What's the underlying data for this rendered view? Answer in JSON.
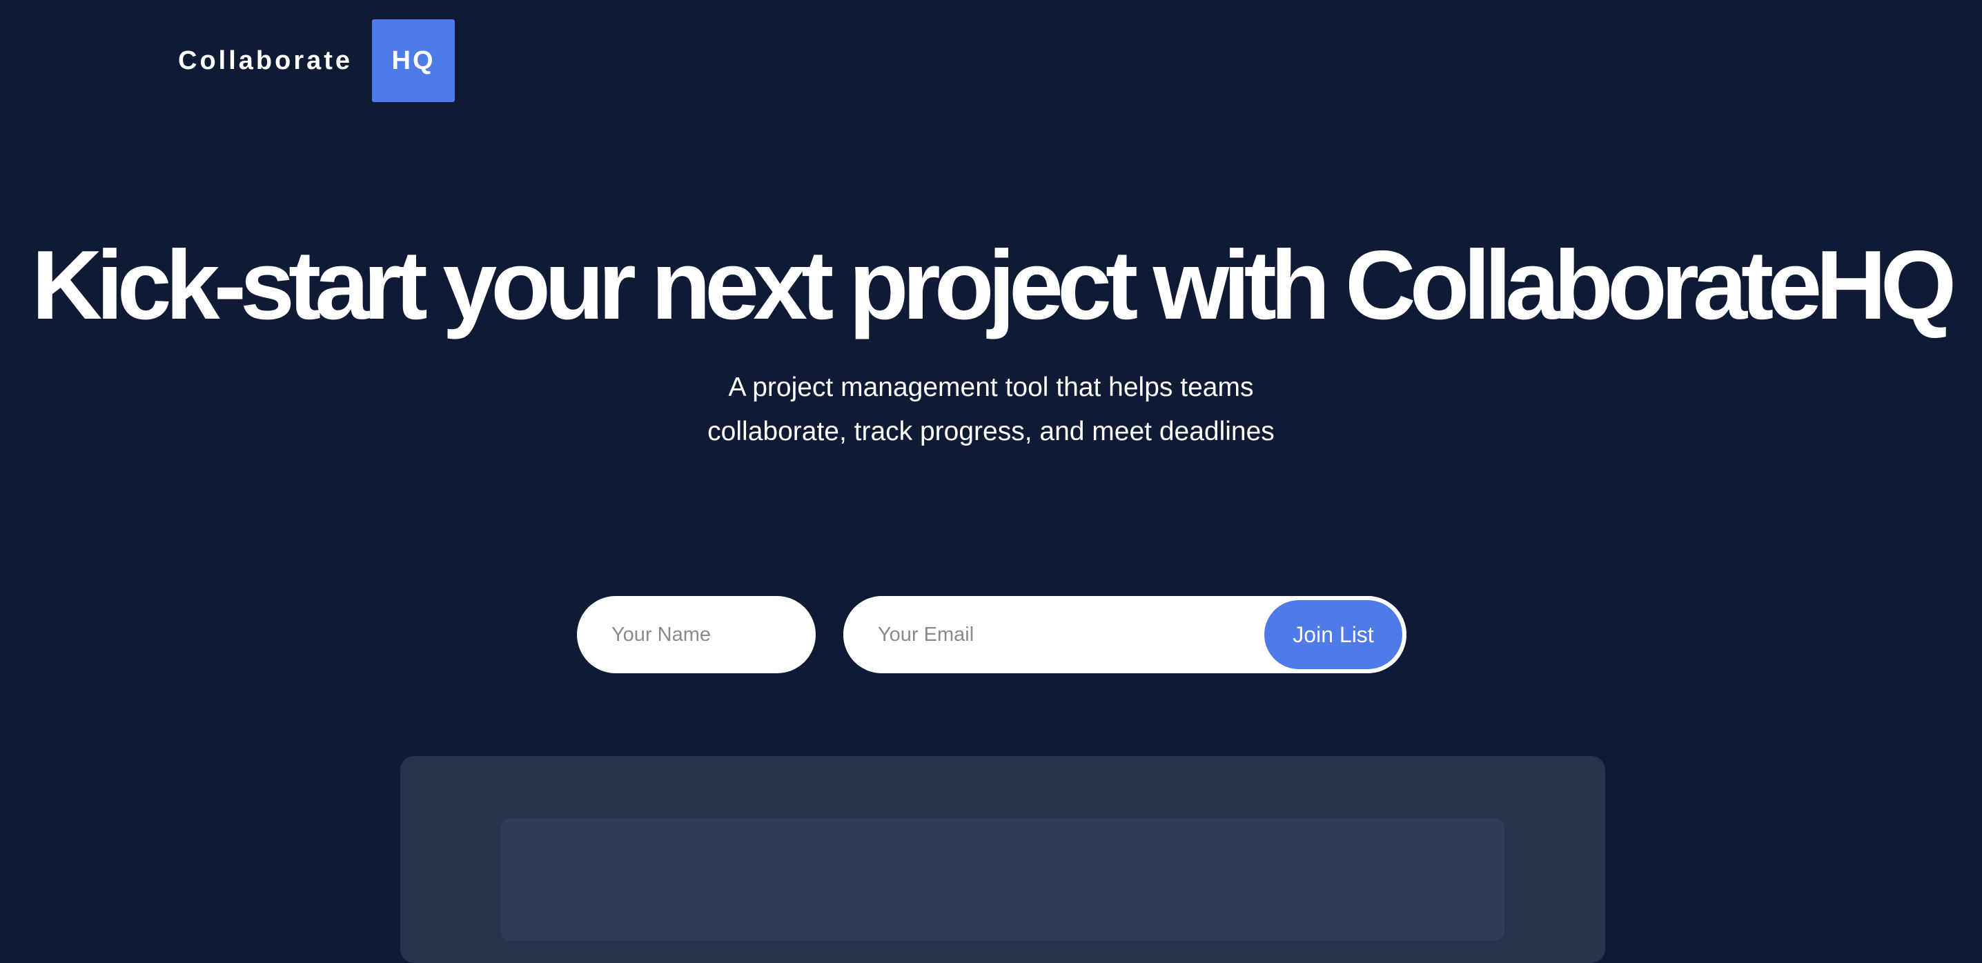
{
  "brand": {
    "name": "Collaborate",
    "badge": "HQ",
    "accent_color": "#4f7be8",
    "background_color": "#0f1a35"
  },
  "hero": {
    "title": "Kick-start your next project with CollaborateHQ",
    "subtitle": "A project management tool that helps teams collaborate, track progress, and meet deadlines"
  },
  "signup": {
    "name_value": "",
    "name_placeholder": "Your Name",
    "email_value": "",
    "email_placeholder": "Your Email",
    "submit_label": "Join List"
  }
}
